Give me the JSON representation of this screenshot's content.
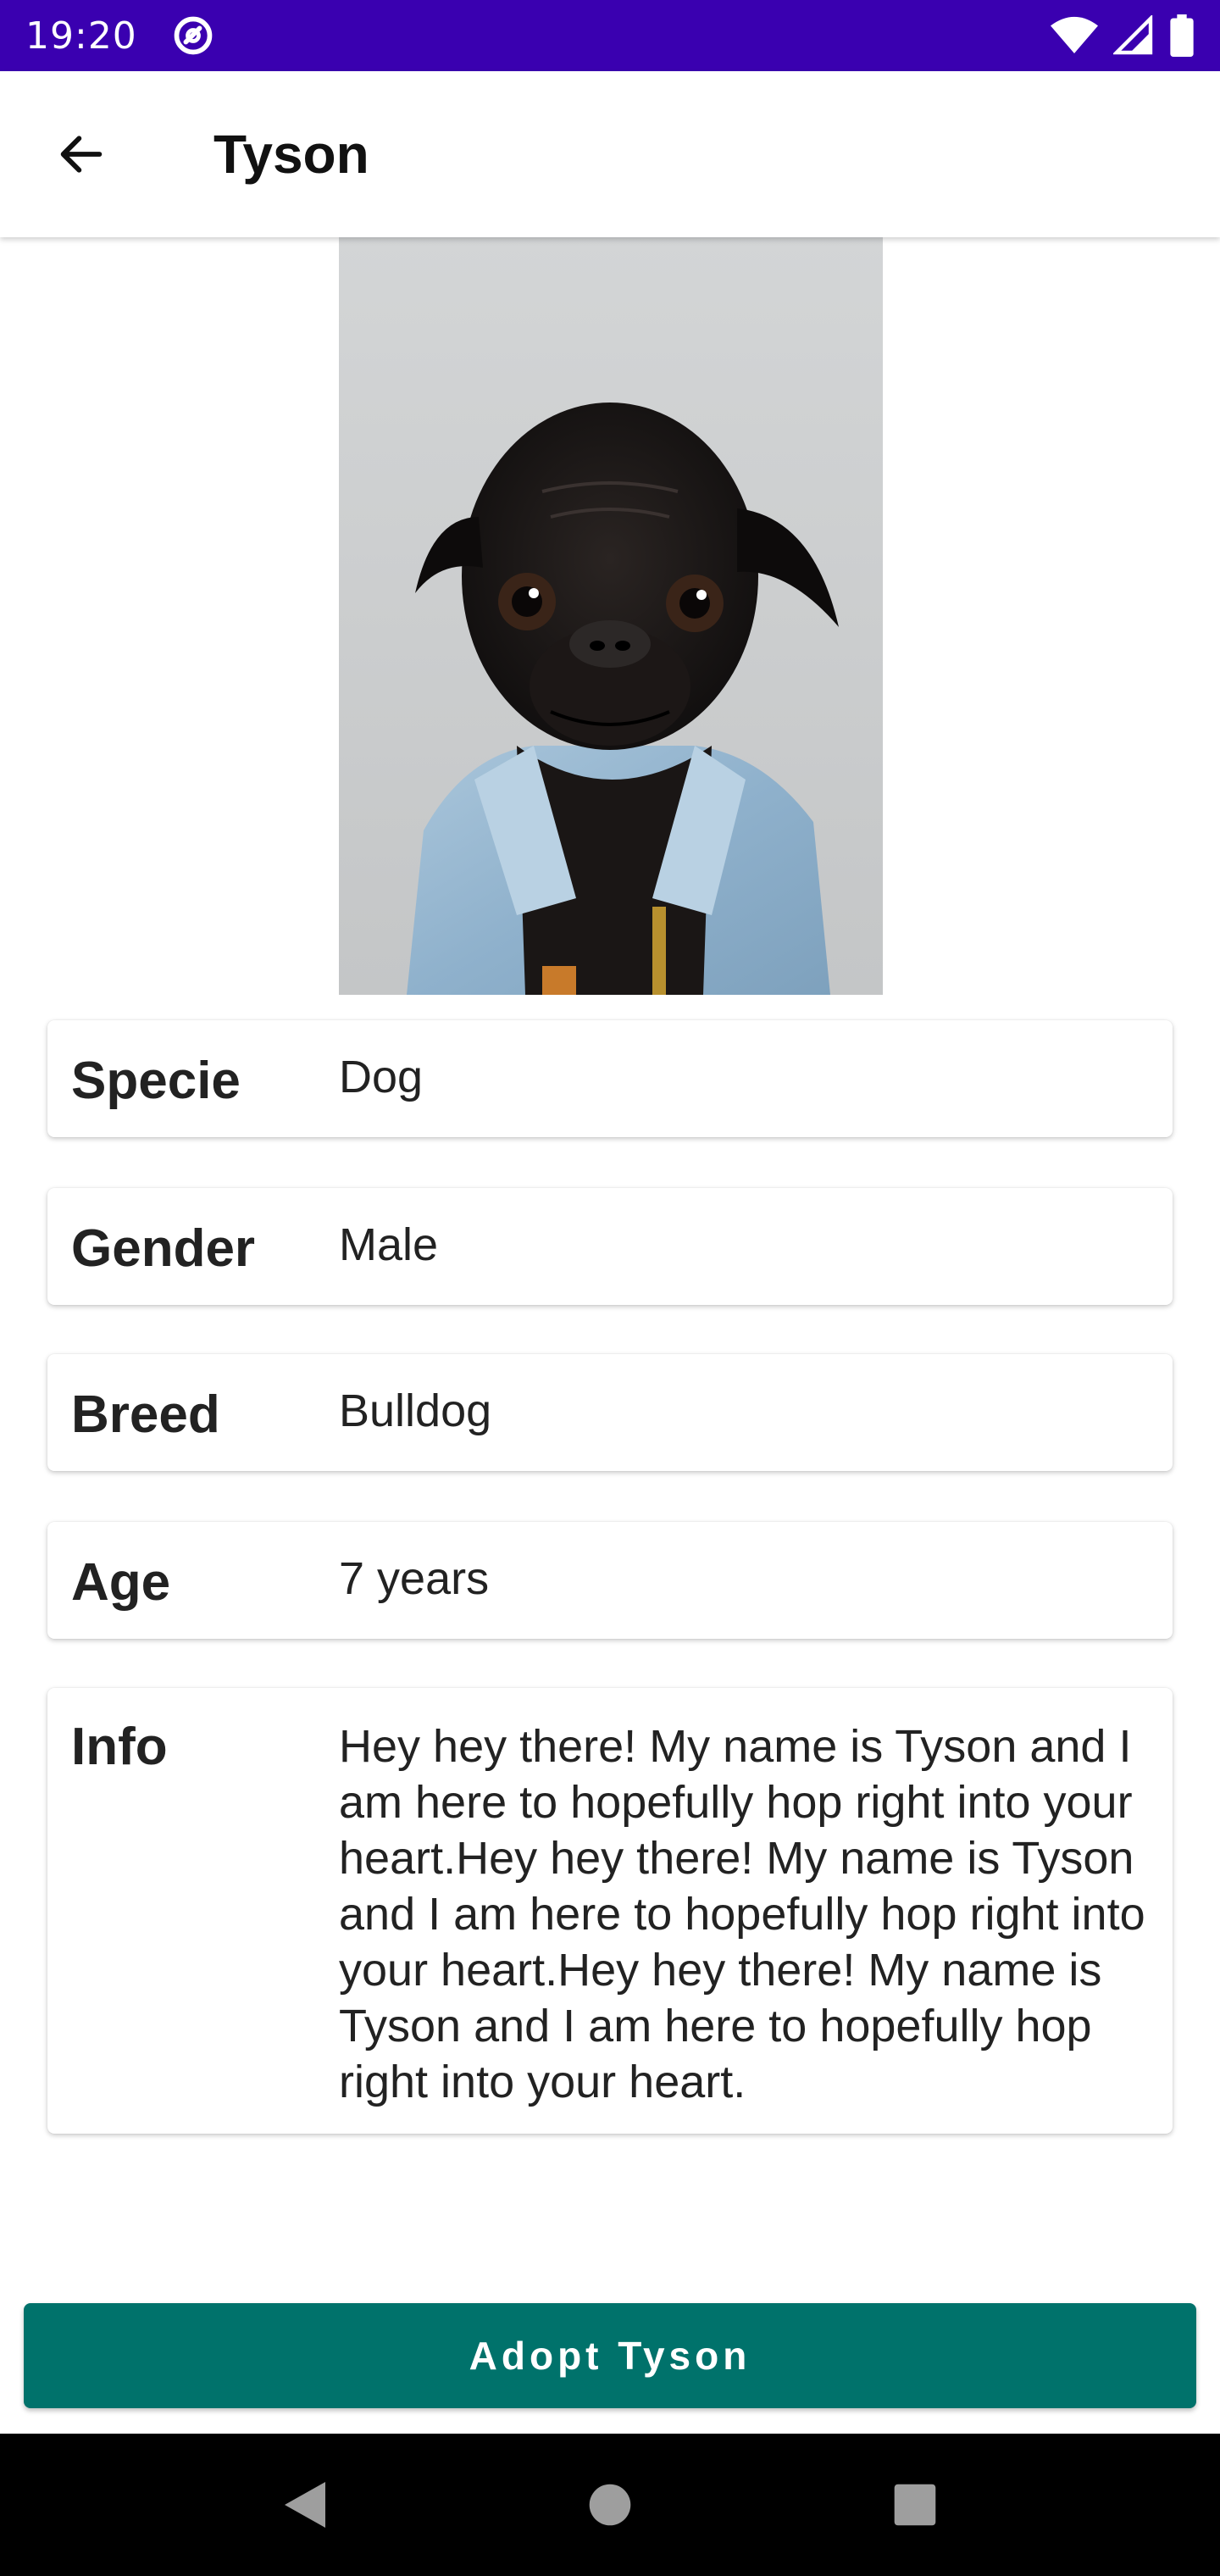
{
  "status_bar": {
    "time": "19:20",
    "icons": [
      "at-sign-icon",
      "wifi-icon",
      "signal-icon",
      "battery-icon"
    ]
  },
  "app_bar": {
    "title": "Tyson",
    "back_icon": "arrow-left-icon"
  },
  "pet": {
    "photo": "pug-in-denim-jacket"
  },
  "details": [
    {
      "label": "Specie",
      "value": "Dog"
    },
    {
      "label": "Gender",
      "value": "Male"
    },
    {
      "label": "Breed",
      "value": "Bulldog"
    },
    {
      "label": "Age",
      "value": "7 years"
    }
  ],
  "info": {
    "label": "Info",
    "text": "Hey hey there! My name is Tyson and I am here to hopefully hop right into your heart.Hey hey there! My name is Tyson and I am here to hopefully hop right into your heart.Hey hey there! My name is Tyson and I am here to hopefully hop right into your heart."
  },
  "adopt_button": {
    "label": "Adopt Tyson"
  },
  "colors": {
    "status_bar": "#3a00b0",
    "accent": "#00726b",
    "nav_bar": "#000000"
  },
  "nav_bar": {
    "icons": [
      "back-triangle-icon",
      "home-circle-icon",
      "recents-square-icon"
    ]
  }
}
